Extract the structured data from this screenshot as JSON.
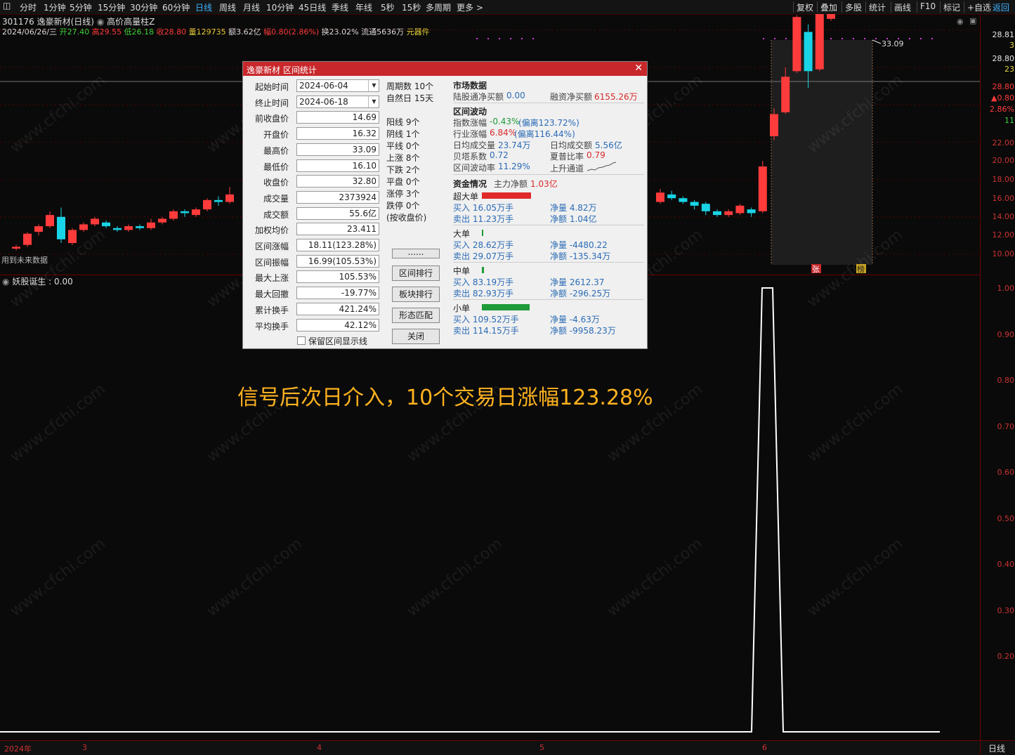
{
  "toolbar": {
    "left_items": [
      "分时",
      "1分钟",
      "5分钟",
      "15分钟",
      "30分钟",
      "60分钟",
      "日线",
      "周线",
      "月线",
      "10分钟",
      "45日线",
      "季线",
      "年线",
      "5秒",
      "15秒",
      "多周期",
      "更多 >"
    ],
    "active": "日线",
    "right_items": [
      "复权",
      "叠加",
      "多股",
      "统计",
      "画线",
      "F10",
      "标记",
      "+自选",
      "返回"
    ]
  },
  "info": {
    "stock": "301176 逸豪新材(日线)",
    "indicator": "高价高量柱Z",
    "date": "2024/06/26/三",
    "open_label": "开",
    "open": "27.40",
    "high_label": "高",
    "high": "29.55",
    "low_label": "低",
    "low": "26.18",
    "close_label": "收",
    "close": "28.80",
    "vol_label": "量",
    "vol": "129735",
    "amt_label": "额",
    "amt": "3.62亿",
    "chg_label": "幅",
    "chg": "0.80(2.86%)",
    "turn_label": "换",
    "turn": "23.02%",
    "float_label": "流通",
    "float": "5636万",
    "sector": "元器件"
  },
  "main_chart": {
    "note": "用到未来数据",
    "top_label": "33.09",
    "mark_zhang": "张",
    "mark_bang": "榜",
    "candles": [
      {
        "o": 10.3,
        "c": 10.4,
        "h": 10.5,
        "l": 10.2
      },
      {
        "o": 10.5,
        "c": 11.1,
        "h": 11.2,
        "l": 10.4
      },
      {
        "o": 11.2,
        "c": 11.5,
        "h": 11.6,
        "l": 11.0
      },
      {
        "o": 11.5,
        "c": 12.1,
        "h": 12.3,
        "l": 11.4
      },
      {
        "o": 12.0,
        "c": 10.8,
        "h": 12.5,
        "l": 10.6
      },
      {
        "o": 10.6,
        "c": 11.3,
        "h": 11.4,
        "l": 10.5
      },
      {
        "o": 11.3,
        "c": 11.6,
        "h": 11.7,
        "l": 11.2
      },
      {
        "o": 11.6,
        "c": 11.9,
        "h": 12.0,
        "l": 11.5
      },
      {
        "o": 11.7,
        "c": 11.5,
        "h": 11.8,
        "l": 11.4
      },
      {
        "o": 11.4,
        "c": 11.3,
        "h": 11.5,
        "l": 11.2
      },
      {
        "o": 11.3,
        "c": 11.5,
        "h": 11.6,
        "l": 11.2
      },
      {
        "o": 11.5,
        "c": 11.4,
        "h": 11.6,
        "l": 11.3
      },
      {
        "o": 11.4,
        "c": 11.7,
        "h": 11.9,
        "l": 11.3
      },
      {
        "o": 11.7,
        "c": 11.9,
        "h": 12.0,
        "l": 11.6
      },
      {
        "o": 11.9,
        "c": 12.3,
        "h": 12.4,
        "l": 11.8
      },
      {
        "o": 12.3,
        "c": 12.2,
        "h": 12.4,
        "l": 12.0
      },
      {
        "o": 12.1,
        "c": 12.4,
        "h": 12.5,
        "l": 12.0
      },
      {
        "o": 12.4,
        "c": 12.9,
        "h": 13.0,
        "l": 12.3
      },
      {
        "o": 12.9,
        "c": 12.8,
        "h": 13.1,
        "l": 12.6
      },
      {
        "o": 12.8,
        "c": 13.2,
        "h": 13.6,
        "l": 12.7
      }
    ],
    "right_candles": [
      {
        "o": 12.8,
        "c": 13.3,
        "h": 13.5,
        "l": 12.7
      },
      {
        "o": 13.2,
        "c": 13.0,
        "h": 13.4,
        "l": 12.9
      },
      {
        "o": 13.0,
        "c": 12.8,
        "h": 13.1,
        "l": 12.7
      },
      {
        "o": 12.8,
        "c": 12.6,
        "h": 12.9,
        "l": 12.4
      },
      {
        "o": 12.7,
        "c": 12.3,
        "h": 12.8,
        "l": 12.1
      },
      {
        "o": 12.3,
        "c": 12.1,
        "h": 12.4,
        "l": 12.0
      },
      {
        "o": 12.1,
        "c": 12.3,
        "h": 12.4,
        "l": 12.0
      },
      {
        "o": 12.2,
        "c": 12.6,
        "h": 12.7,
        "l": 12.1
      },
      {
        "o": 12.4,
        "c": 12.2,
        "h": 12.5,
        "l": 12.0
      },
      {
        "o": 12.3,
        "c": 14.7,
        "h": 15.0,
        "l": 12.2
      },
      {
        "o": 16.32,
        "c": 17.5,
        "h": 17.8,
        "l": 16.1
      },
      {
        "o": 17.6,
        "c": 19.5,
        "h": 20.0,
        "l": 17.5
      },
      {
        "o": 19.8,
        "c": 22.7,
        "h": 22.8,
        "l": 19.7
      },
      {
        "o": 21.9,
        "c": 19.8,
        "h": 22.3,
        "l": 18.9
      },
      {
        "o": 19.9,
        "c": 23.8,
        "h": 23.9,
        "l": 19.8
      },
      {
        "o": 22.6,
        "c": 24.6,
        "h": 25.1,
        "l": 22.5
      },
      {
        "o": 24.6,
        "c": 25.6,
        "h": 26.3,
        "l": 23.8
      },
      {
        "o": 25.6,
        "c": 27.4,
        "h": 28.4,
        "l": 25.4
      },
      {
        "o": 28.9,
        "c": 32.8,
        "h": 33.0,
        "l": 28.7
      },
      {
        "o": 32.8,
        "c": 30.4,
        "h": 33.09,
        "l": 30.2
      },
      {
        "o": 31.4,
        "c": 32.2,
        "h": 32.3,
        "l": 30.4
      },
      {
        "o": 30.8,
        "c": 29.7,
        "h": 32.3,
        "l": 28.6
      },
      {
        "o": 29.7,
        "c": 28.4,
        "h": 29.9,
        "l": 26.9
      },
      {
        "o": 27.2,
        "c": 28.3,
        "h": 28.6,
        "l": 27.0
      },
      {
        "o": 27.4,
        "c": 28.8,
        "h": 29.55,
        "l": 26.18
      },
      {
        "o": 28.6,
        "c": 29.9,
        "h": 31.0,
        "l": 28.0
      }
    ]
  },
  "right_axis_top": [
    {
      "v": "28.81",
      "c": "#e6e6e6"
    },
    {
      "v": "3",
      "c": "#e6d23a"
    },
    {
      "v": "28.80",
      "c": "#e6e6e6"
    },
    {
      "v": "23",
      "c": "#e6d23a"
    },
    {
      "v": "28.80",
      "c": "#ff3b3b"
    },
    {
      "v": "▲0.80",
      "c": "#ff3b3b"
    },
    {
      "v": "2.86%",
      "c": "#ff3b3b"
    },
    {
      "v": "11",
      "c": "#3bd43b"
    },
    {
      "v": "22.00",
      "c": "#c33"
    },
    {
      "v": "20.00",
      "c": "#c33"
    },
    {
      "v": "18.00",
      "c": "#c33"
    },
    {
      "v": "16.00",
      "c": "#c33"
    },
    {
      "v": "14.00",
      "c": "#c33"
    },
    {
      "v": "12.00",
      "c": "#c33"
    },
    {
      "v": "10.00",
      "c": "#c33"
    }
  ],
  "indicator": {
    "name": "妖股诞生",
    "value": ": 0.00",
    "axis": [
      "1.00",
      "0.90",
      "0.80",
      "0.70",
      "0.60",
      "0.50",
      "0.40",
      "0.30",
      "0.20"
    ],
    "spike_at": 1
  },
  "bottom_axis": {
    "labels": [
      "2024年",
      "3",
      "4",
      "5",
      "6"
    ],
    "right": "日线"
  },
  "dialog": {
    "title": "逸豪新材 区间统计",
    "fields": [
      {
        "label": "起始时间",
        "value": "2024-06-04",
        "combo": true
      },
      {
        "label": "终止时间",
        "value": "2024-06-18",
        "combo": true
      },
      {
        "label": "前收盘价",
        "value": "14.69"
      },
      {
        "label": "开盘价",
        "value": "16.32"
      },
      {
        "label": "最高价",
        "value": "33.09"
      },
      {
        "label": "最低价",
        "value": "16.10"
      },
      {
        "label": "收盘价",
        "value": "32.80"
      },
      {
        "label": "成交量",
        "value": "2373924"
      },
      {
        "label": "成交额",
        "value": "55.6亿"
      },
      {
        "label": "加权均价",
        "value": "23.411"
      },
      {
        "label": "区间涨幅",
        "value": "18.11(123.28%)"
      },
      {
        "label": "区间振幅",
        "value": "16.99(105.53%)"
      },
      {
        "label": "最大上涨",
        "value": "105.53%"
      },
      {
        "label": "最大回撤",
        "value": "-19.77%"
      },
      {
        "label": "累计换手",
        "value": "421.24%"
      },
      {
        "label": "平均换手",
        "value": "42.12%"
      }
    ],
    "keep_line": "保留区间显示线",
    "mid_top": [
      "周期数 10个",
      "自然日 15天"
    ],
    "mid_counts": [
      "阳线 9个",
      "阴线 1个",
      "平线 0个",
      "上涨 8个",
      "下跌 2个",
      "平盘 0个",
      "涨停 3个",
      "跌停 0个",
      "(按收盘价)"
    ],
    "buttons": [
      "......",
      "区间排行",
      "板块排行",
      "形态匹配",
      "关闭"
    ],
    "market": {
      "title": "市场数据",
      "hk_label": "陆股通净买额",
      "hk_value": "0.00",
      "margin_label": "融资净买额",
      "margin_value": "6155.26万"
    },
    "wave": {
      "title": "区间波动",
      "idx_label": "指数涨幅",
      "idx_value": "-0.43%",
      "idx_dev": "(偏离123.72%)",
      "ind_label": "行业涨幅",
      "ind_value": "6.84%",
      "ind_dev": "(偏离116.44%)",
      "avgvol_label": "日均成交量",
      "avgvol": "23.74万",
      "avgamt_label": "日均成交额",
      "avgamt": "5.56亿",
      "beta_label": "贝塔系数",
      "beta": "0.72",
      "sharpe_label": "夏普比率",
      "sharpe": "0.79",
      "vola_label": "区间波动率",
      "vola": "11.29%",
      "channel_label": "上升通道"
    },
    "funds": {
      "title": "资金情况",
      "main_label": "主力净额",
      "main_value": "1.03亿",
      "groups": [
        {
          "name": "超大单",
          "bar": "red",
          "bar_w": 70,
          "buy": "买入 16.05万手",
          "sell": "卖出 11.23万手",
          "net": "净量 4.82万",
          "amt": "净额 1.04亿"
        },
        {
          "name": "大单",
          "bar": "green",
          "bar_w": 2,
          "buy": "买入 28.62万手",
          "sell": "卖出 29.07万手",
          "net": "净量 -4480.22",
          "amt": "净额 -135.34万"
        },
        {
          "name": "中单",
          "bar": "green",
          "bar_w": 3,
          "buy": "买入 83.19万手",
          "sell": "卖出 82.93万手",
          "net": "净量 2612.37",
          "amt": "净额 -296.25万"
        },
        {
          "name": "小单",
          "bar": "green",
          "bar_w": 68,
          "buy": "买入 109.52万手",
          "sell": "卖出 114.15万手",
          "net": "净量 -4.63万",
          "amt": "净额 -9958.23万"
        }
      ]
    }
  },
  "annotation": "信号后次日介入，10个交易日涨幅123.28%"
}
